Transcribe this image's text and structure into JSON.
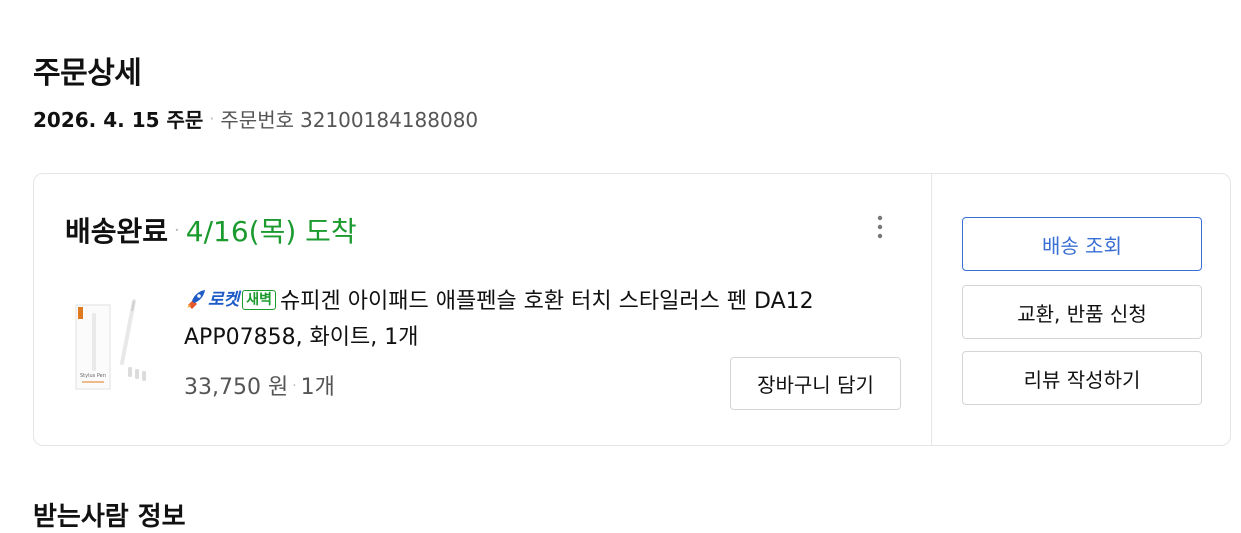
{
  "page": {
    "title": "주문상세",
    "order_date": "2026. 4. 15 주문",
    "order_number_label": "주문번호",
    "order_number": "32100184188080"
  },
  "shipment": {
    "status": "배송완료",
    "arrival": "4/16(목) 도착",
    "more_icon": "more-vertical-icon"
  },
  "product": {
    "badge_rocket": "로켓",
    "badge_dawn": "새벽",
    "name": "슈피겐 아이패드 애플펜슬 호환 터치 스타일러스 펜 DA12 APP07858, 화이트, 1개",
    "price": "33,750 원",
    "quantity": "1개",
    "cart_button": "장바구니 담기",
    "thumb_label": "Stylus Pen"
  },
  "actions": {
    "track": "배송 조회",
    "return": "교환, 반품 신청",
    "review": "리뷰 작성하기"
  },
  "next_section": {
    "title": "받는사람 정보"
  },
  "colors": {
    "arrival_green": "#1b9a2e",
    "rocket_blue": "#1e5bc6",
    "track_blue": "#3a6fd4"
  }
}
